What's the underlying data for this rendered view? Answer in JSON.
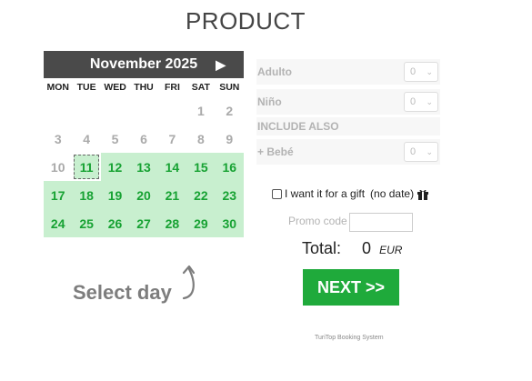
{
  "page": {
    "title": "PRODUCT"
  },
  "calendar": {
    "month_label": "November 2025",
    "next_symbol": "▶",
    "weekdays": [
      "MON",
      "TUE",
      "WED",
      "THU",
      "FRI",
      "SAT",
      "SUN"
    ],
    "weeks": [
      [
        {
          "d": ""
        },
        {
          "d": ""
        },
        {
          "d": ""
        },
        {
          "d": ""
        },
        {
          "d": ""
        },
        {
          "d": "1"
        },
        {
          "d": "2"
        }
      ],
      [
        {
          "d": "3"
        },
        {
          "d": "4"
        },
        {
          "d": "5"
        },
        {
          "d": "6"
        },
        {
          "d": "7"
        },
        {
          "d": "8"
        },
        {
          "d": "9"
        }
      ],
      [
        {
          "d": "10"
        },
        {
          "d": "11",
          "a": true,
          "today": true
        },
        {
          "d": "12",
          "a": true
        },
        {
          "d": "13",
          "a": true
        },
        {
          "d": "14",
          "a": true
        },
        {
          "d": "15",
          "a": true
        },
        {
          "d": "16",
          "a": true
        }
      ],
      [
        {
          "d": "17",
          "a": true
        },
        {
          "d": "18",
          "a": true
        },
        {
          "d": "19",
          "a": true
        },
        {
          "d": "20",
          "a": true
        },
        {
          "d": "21",
          "a": true
        },
        {
          "d": "22",
          "a": true
        },
        {
          "d": "23",
          "a": true
        }
      ],
      [
        {
          "d": "24",
          "a": true
        },
        {
          "d": "25",
          "a": true
        },
        {
          "d": "26",
          "a": true
        },
        {
          "d": "27",
          "a": true
        },
        {
          "d": "28",
          "a": true
        },
        {
          "d": "29",
          "a": true
        },
        {
          "d": "30",
          "a": true
        }
      ]
    ]
  },
  "hint": {
    "select_day": "Select day"
  },
  "form": {
    "adulto": {
      "label": "Adulto",
      "value": "0"
    },
    "nino": {
      "label": "Niño",
      "value": "0"
    },
    "include_also": "INCLUDE ALSO",
    "bebe": {
      "label": "+ Bebé",
      "value": "0"
    },
    "gift": {
      "label": "I want it for a gift",
      "note": "(no date)",
      "icon": "gift-icon"
    },
    "promo": {
      "label": "Promo code",
      "value": ""
    },
    "total": {
      "label": "Total:",
      "amount": "0",
      "currency": "EUR"
    },
    "next_button": "NEXT >>"
  },
  "footer": {
    "text": "TuriTop Booking System"
  },
  "colors": {
    "header_bg": "#4a4a4a",
    "available_bg": "#c8efcf",
    "available_text": "#17a233",
    "button": "#1faa3b"
  }
}
